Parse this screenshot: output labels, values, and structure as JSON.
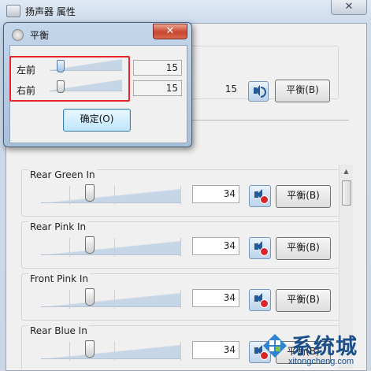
{
  "main_window": {
    "title": "扬声器 属性",
    "close_glyph": "✕",
    "upper_level": {
      "value": "15",
      "balance_label": "平衡(B)"
    }
  },
  "channels": [
    {
      "name": "Rear Green In",
      "value": "34",
      "balance_label": "平衡(B)",
      "muted": true
    },
    {
      "name": "Rear Pink In",
      "value": "34",
      "balance_label": "平衡(B)",
      "muted": true
    },
    {
      "name": "Front Pink In",
      "value": "34",
      "balance_label": "平衡(B)",
      "muted": true
    },
    {
      "name": "Rear Blue In",
      "value": "34",
      "balance_label": "平衡(B)",
      "muted": true
    }
  ],
  "balance_dialog": {
    "title": "平衡",
    "close_glyph": "✕",
    "rows": [
      {
        "label": "左前",
        "value": "15"
      },
      {
        "label": "右前",
        "value": "15"
      }
    ],
    "ok_label": "确定(O)"
  },
  "watermark": {
    "brand": "系统城",
    "url": "xitongcheng.com"
  },
  "colors": {
    "highlight": "#e8252f",
    "watermark": "#1b4f8c",
    "dialog_close": "#c7452e"
  }
}
